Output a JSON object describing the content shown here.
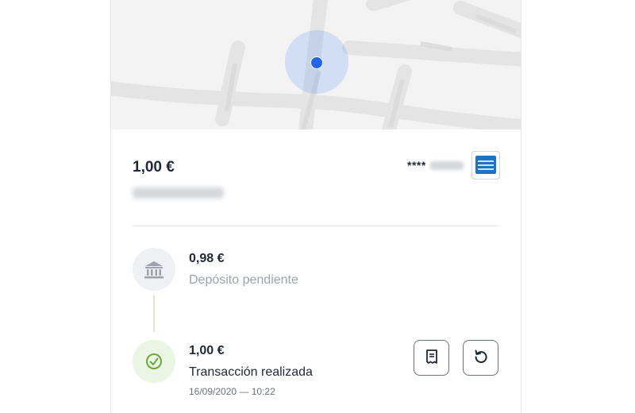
{
  "transaction": {
    "amount": "1,00 €",
    "card_masked": "****"
  },
  "timeline": [
    {
      "amount": "0,98 €",
      "label": "Depósito pendiente",
      "icon": "bank-icon"
    },
    {
      "amount": "1,00 €",
      "label": "Transacción realizada",
      "time": "16/09/2020 — 10:22",
      "icon": "check-circle-icon"
    }
  ],
  "colors": {
    "map_pin": "#2563eb",
    "amex_blue": "#1d74c5",
    "success_green": "#6aaa3a",
    "pending_gray": "#9ca3af"
  }
}
